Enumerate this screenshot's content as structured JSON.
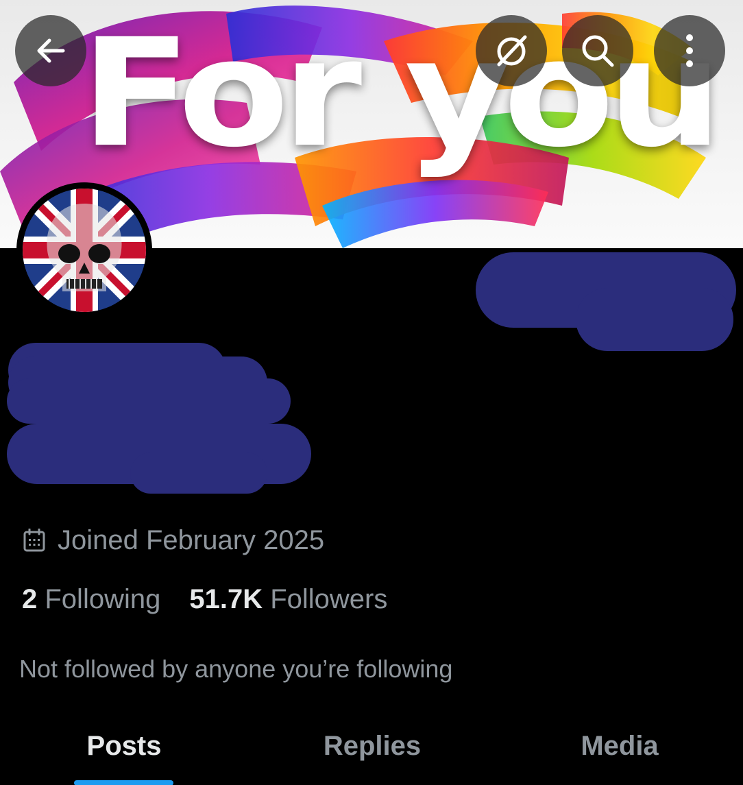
{
  "banner": {
    "title": "For you"
  },
  "top_bar": {
    "back_icon": "arrow-left-icon",
    "grok_icon": "grok-icon",
    "search_icon": "search-icon",
    "more_icon": "more-vertical-icon"
  },
  "profile": {
    "avatar_icon": "union-jack-skull-avatar",
    "joined": "Joined February 2025",
    "following_count": "2",
    "following_label": "Following",
    "followers_count": "51.7K",
    "followers_label": "Followers",
    "not_followed_text": "Not followed by anyone you’re following"
  },
  "tabs": [
    {
      "label": "Posts",
      "active": true
    },
    {
      "label": "Replies",
      "active": false
    },
    {
      "label": "Media",
      "active": false
    }
  ],
  "colors": {
    "background": "#000000",
    "redaction": "#2b2d7c",
    "tab_indicator": "#1d9bf0",
    "muted_text": "#8f969d",
    "primary_text": "#e7e9ea"
  }
}
